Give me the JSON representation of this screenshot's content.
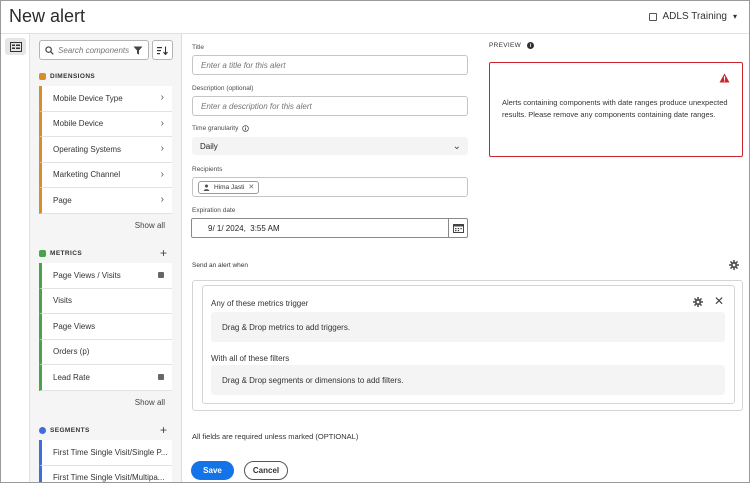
{
  "header": {
    "title": "New alert",
    "org_name": "ADLS Training"
  },
  "panel": {
    "search_placeholder": "Search components",
    "dimensions": {
      "heading": "DIMENSIONS",
      "items": [
        "Mobile Device Type",
        "Mobile Device",
        "Operating Systems",
        "Marketing Channel",
        "Page"
      ],
      "show_all": "Show all"
    },
    "metrics": {
      "heading": "METRICS",
      "items": [
        "Page Views / Visits",
        "Visits",
        "Page Views",
        "Orders (p)",
        "Lead Rate"
      ],
      "show_all": "Show all"
    },
    "segments": {
      "heading": "SEGMENTS",
      "items": [
        "First Time Single Visit/Single P...",
        "First Time Single Visit/Multipa..."
      ]
    }
  },
  "form": {
    "title_label": "Title",
    "title_placeholder": "Enter a title for this alert",
    "description_label": "Description (optional)",
    "description_placeholder": "Enter a description for this alert",
    "granularity_label": "Time granularity",
    "granularity_value": "Daily",
    "recipients_label": "Recipients",
    "recipient": "Hima Jasti",
    "expiration_label": "Expiration date",
    "expiration_value": "9/ 1/ 2024,  3:55 AM"
  },
  "preview": {
    "label": "PREVIEW",
    "message": "Alerts containing components with date ranges produce unexpected results. Please remove any components containing date ranges."
  },
  "alert_when": {
    "label": "Send an alert when",
    "metrics_title": "Any of these metrics trigger",
    "metrics_drop": "Drag & Drop metrics to add triggers.",
    "filters_title": "With all of these filters",
    "filters_drop": "Drag & Drop segments or dimensions to add filters."
  },
  "footer": {
    "required_note": "All fields are required unless marked (OPTIONAL)",
    "save": "Save",
    "cancel": "Cancel"
  },
  "colors": {
    "accent": "#1473e6",
    "dimension": "#d98c2b",
    "metric": "#49a34a",
    "segment": "#3f6ed8",
    "error": "#c9252d"
  }
}
